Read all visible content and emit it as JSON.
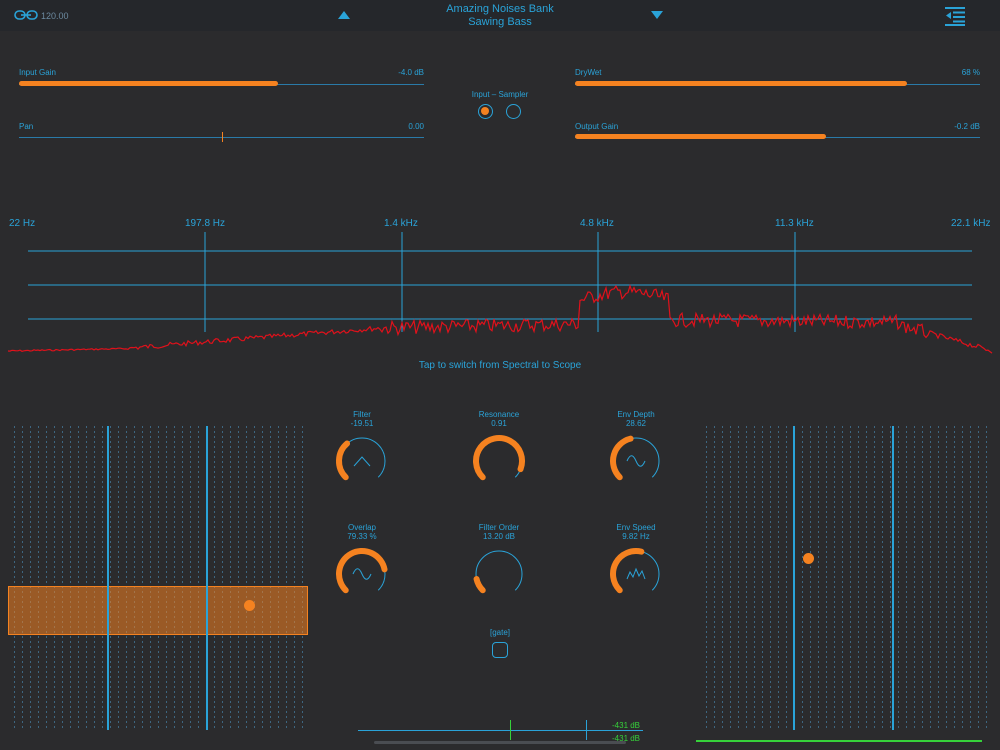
{
  "header": {
    "tempo": "120.00",
    "bank": "Amazing Noises Bank",
    "preset": "Sawing Bass"
  },
  "sliders": {
    "input_gain": {
      "label": "Input Gain",
      "value": "-4.0 dB",
      "level": 0.78
    },
    "pan": {
      "label": "Pan",
      "value": "0.00",
      "level": 0.5
    },
    "dry_wet": {
      "label": "DryWet",
      "value": "68 %",
      "level": 0.82
    },
    "output_gain": {
      "label": "Output Gain",
      "value": "-0.2 dB",
      "level": 0.62
    }
  },
  "input_mode": {
    "label": "Input – Sampler",
    "selected": "input"
  },
  "spectrum": {
    "freq_labels": [
      "22 Hz",
      "197.8 Hz",
      "1.4 kHz",
      "4.8 kHz",
      "11.3 kHz",
      "22.1 kHz"
    ],
    "hint": "Tap to switch from Spectral to Scope"
  },
  "knobs": [
    {
      "label": "Filter",
      "value": "-19.51",
      "level": 0.35,
      "icon": "lowpass-icon"
    },
    {
      "label": "Resonance",
      "value": "0.91",
      "level": 0.91,
      "icon": ""
    },
    {
      "label": "Env Depth",
      "value": "28.62",
      "level": 0.45,
      "icon": "sine-icon"
    },
    {
      "label": "Overlap",
      "value": "79.33 %",
      "level": 0.79,
      "icon": "sine-icon"
    },
    {
      "label": "Filter Order",
      "value": "13.20 dB",
      "level": 0.12,
      "icon": ""
    },
    {
      "label": "Env Speed",
      "value": "9.82 Hz",
      "level": 0.55,
      "icon": "envelope-icon"
    }
  ],
  "gate": {
    "label": "[gate]"
  },
  "meters": {
    "top": "-431 dB",
    "bottom": "-431 dB"
  },
  "colors": {
    "accent": "#f58220",
    "primary": "#2aa3d8",
    "background": "#2b2b2d",
    "spectrum": "#e0111b",
    "meter": "#36d13a"
  }
}
